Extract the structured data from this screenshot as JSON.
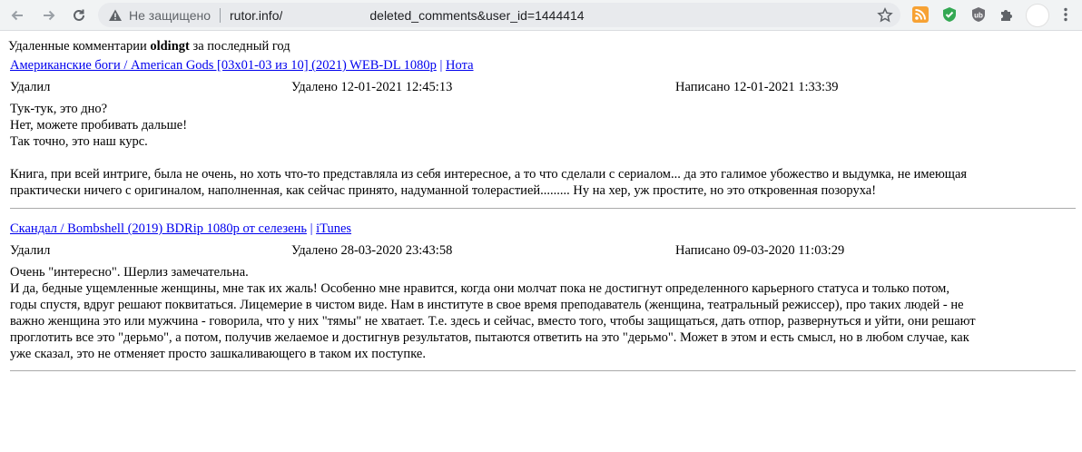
{
  "browser": {
    "security_label": "Не защищено",
    "url_host": "rutor.info/",
    "url_path": "deleted_comments&user_id=1444414",
    "extensions": [
      "rss-icon",
      "shield-check-icon",
      "ublock-icon",
      "puzzle-icon",
      "profile-avatar"
    ]
  },
  "page": {
    "heading_prefix": "Удаленные комментарии",
    "heading_user": "oldingt",
    "heading_suffix": "за последный год"
  },
  "comments": [
    {
      "title": "Американские боги / American Gods [03x01-03 из 10] (2021) WEB-DL 1080p",
      "source": "Нота",
      "action": "Удалил",
      "deleted": "Удалено 12-01-2021 12:45:13",
      "written": "Написано 12-01-2021 1:33:39",
      "body": "Тук-тук, это дно?\nНет, можете пробивать дальше!\nТак точно, это наш курс.\n\nКнига, при всей интриге, была не очень, но хоть что-то представляла из себя интересное, а то что сделали с сериалом... да это галимое убожество и выдумка, не имеющая\nпрактически ничего с оригиналом, наполненная, как сейчас принято, надуманной толерастией......... Ну на хер, уж простите, но это откровенная позоруха!"
    },
    {
      "title": "Скандал / Bombshell (2019) BDRip 1080p от селезень",
      "source": "iTunes",
      "action": "Удалил",
      "deleted": "Удалено 28-03-2020 23:43:58",
      "written": "Написано 09-03-2020 11:03:29",
      "body": "Очень \"интересно\". Шерлиз замечательна.\nИ да, бедные ущемленные женщины, мне так их жаль! Особенно мне нравится, когда они молчат пока не достигнут определенного карьерного статуса и только потом,\nгоды спустя, вдруг решают поквитаться. Лицемерие в чистом виде. Нам в институте в свое время преподаватель (женщина, театральный режиссер), про таких людей - не\nважно женщина это или мужчина - говорила, что у них \"тямы\" не хватает. Т.е. здесь и сейчас, вместо того, чтобы защищаться, дать отпор, развернуться и уйти, они решают\nпроглотить все это \"дерьмо\", а потом, получив желаемое и достигнув результатов, пытаются ответить на это \"дерьмо\". Может в этом и есть смысл, но в любом случае, как\nуже сказал, это не отменяет просто зашкаливающего в таком их поступке."
    }
  ]
}
